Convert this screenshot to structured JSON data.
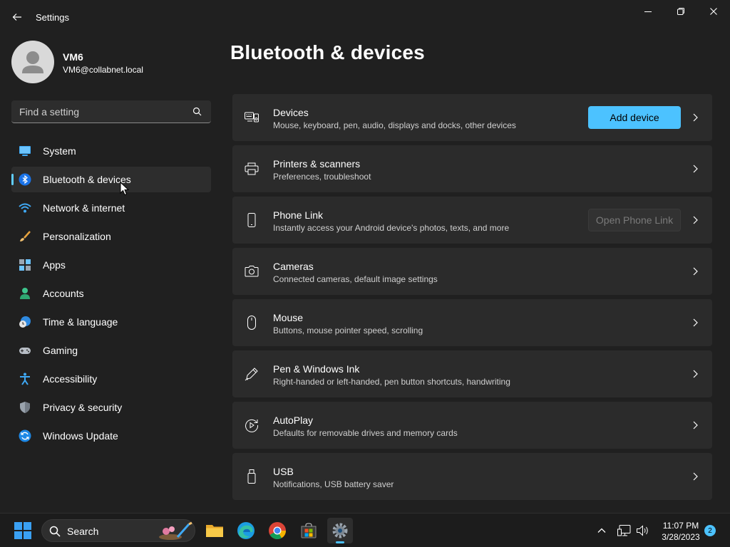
{
  "window": {
    "title": "Settings"
  },
  "profile": {
    "name": "VM6",
    "email": "VM6@collabnet.local"
  },
  "search": {
    "placeholder": "Find a setting"
  },
  "nav": {
    "items": [
      {
        "label": "System",
        "icon": "system-icon"
      },
      {
        "label": "Bluetooth & devices",
        "icon": "bluetooth-icon",
        "selected": true
      },
      {
        "label": "Network & internet",
        "icon": "wifi-icon"
      },
      {
        "label": "Personalization",
        "icon": "brush-icon"
      },
      {
        "label": "Apps",
        "icon": "apps-icon"
      },
      {
        "label": "Accounts",
        "icon": "person-icon"
      },
      {
        "label": "Time & language",
        "icon": "globe-clock-icon"
      },
      {
        "label": "Gaming",
        "icon": "gamepad-icon"
      },
      {
        "label": "Accessibility",
        "icon": "accessibility-icon"
      },
      {
        "label": "Privacy & security",
        "icon": "shield-icon"
      },
      {
        "label": "Windows Update",
        "icon": "update-icon"
      }
    ]
  },
  "main": {
    "title": "Bluetooth & devices",
    "cards": [
      {
        "title": "Devices",
        "desc": "Mouse, keyboard, pen, audio, displays and docks, other devices",
        "icon": "devices-icon",
        "button": "Add device"
      },
      {
        "title": "Printers & scanners",
        "desc": "Preferences, troubleshoot",
        "icon": "printer-icon"
      },
      {
        "title": "Phone Link",
        "desc": "Instantly access your Android device's photos, texts, and more",
        "icon": "phone-icon",
        "button": "Open Phone Link"
      },
      {
        "title": "Cameras",
        "desc": "Connected cameras, default image settings",
        "icon": "camera-icon"
      },
      {
        "title": "Mouse",
        "desc": "Buttons, mouse pointer speed, scrolling",
        "icon": "mouse-icon"
      },
      {
        "title": "Pen & Windows Ink",
        "desc": "Right-handed or left-handed, pen button shortcuts, handwriting",
        "icon": "pen-icon"
      },
      {
        "title": "AutoPlay",
        "desc": "Defaults for removable drives and memory cards",
        "icon": "autoplay-icon"
      },
      {
        "title": "USB",
        "desc": "Notifications, USB battery saver",
        "icon": "usb-icon"
      }
    ]
  },
  "taskbar": {
    "search_label": "Search",
    "time": "11:07 PM",
    "date": "3/28/2023",
    "notification_count": "2"
  },
  "colors": {
    "accent": "#4cc2ff",
    "background": "#202020",
    "card": "#2b2b2b"
  }
}
